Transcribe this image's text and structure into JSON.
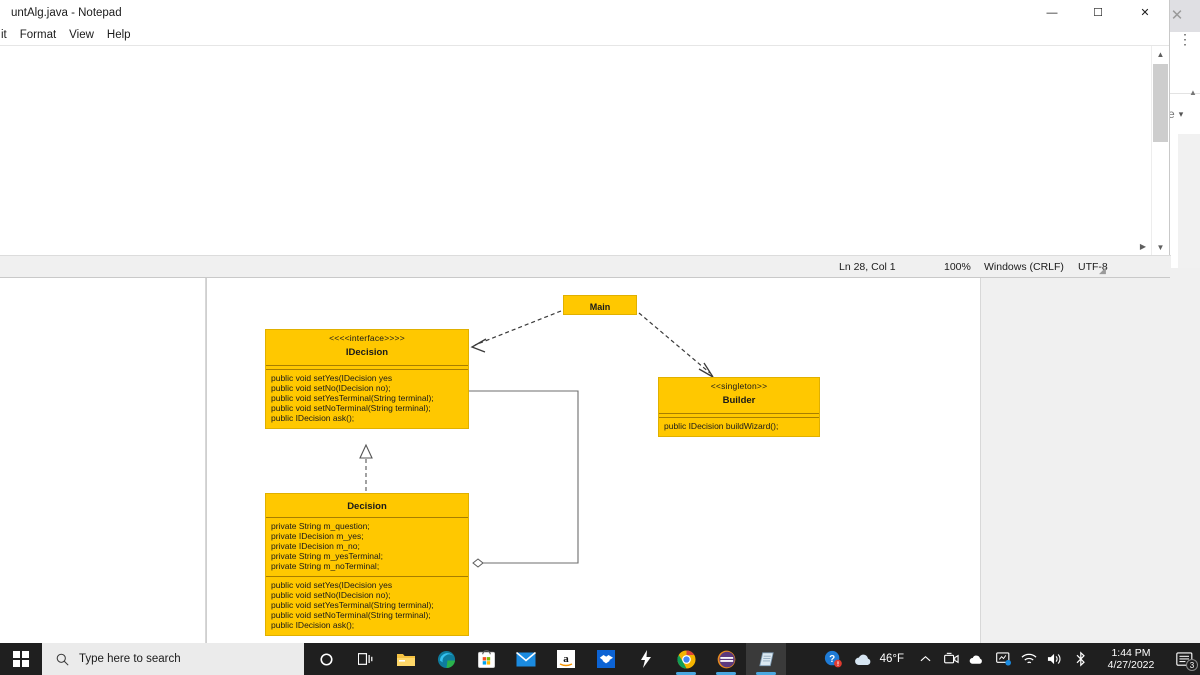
{
  "notepad": {
    "title": "untAlg.java - Notepad",
    "menu": [
      "it",
      "Format",
      "View",
      "Help"
    ],
    "window_controls": [
      {
        "name": "minimize",
        "glyph": "—"
      },
      {
        "name": "maximize",
        "glyph": "☐"
      },
      {
        "name": "close",
        "glyph": "✕"
      }
    ],
    "status": {
      "position": "Ln 28, Col 1",
      "zoom": "100%",
      "line_ending": "Windows (CRLF)",
      "encoding": "UTF-8"
    }
  },
  "background_window": {
    "close_glyph": "✕",
    "kebab_glyph": "⋮",
    "dropdown_label": "e",
    "dropdown_caret": "▾"
  },
  "diagram": {
    "type": "uml-class-diagram",
    "box_fill": "#FFC800",
    "box_border": "#E0B000",
    "separator_color": "#A87E00",
    "classes": [
      {
        "id": "main",
        "name": "Main",
        "stereotype": "",
        "attributes": [],
        "operations": []
      },
      {
        "id": "idecision",
        "name": "IDecision",
        "stereotype": "<<<<interface>>>>",
        "attributes": [],
        "operations": [
          "public void setYes(IDecision yes",
          "public void setNo(IDecision no);",
          "public void setYesTerminal(String terminal);",
          "public void setNoTerminal(String terminal);",
          "public IDecision ask();"
        ]
      },
      {
        "id": "builder",
        "name": "Builder",
        "stereotype": "<<singleton>>",
        "attributes": [],
        "operations": [
          "public IDecision buildWizard();"
        ]
      },
      {
        "id": "decision",
        "name": "Decision",
        "stereotype": "",
        "attributes": [
          "private String m_question;",
          "private IDecision m_yes;",
          "private IDecision m_no;",
          "private String m_yesTerminal;",
          "private String m_noTerminal;"
        ],
        "operations": [
          "public void setYes(IDecision yes",
          "public void setNo(IDecision no);",
          "public void setYesTerminal(String terminal);",
          "public void setNoTerminal(String terminal);",
          "public IDecision ask();"
        ]
      }
    ],
    "relations": [
      {
        "from": "main",
        "to": "idecision",
        "kind": "dependency",
        "style": "dashed-open-arrow"
      },
      {
        "from": "main",
        "to": "builder",
        "kind": "dependency",
        "style": "dashed-open-arrow"
      },
      {
        "from": "decision",
        "to": "idecision",
        "kind": "realization",
        "style": "dashed-hollow-triangle"
      },
      {
        "from": "decision",
        "to": "idecision",
        "kind": "aggregation",
        "style": "solid-hollow-diamond"
      }
    ]
  },
  "taskbar": {
    "start_name": "windows-start",
    "search_placeholder": "Type here to search",
    "buttons": [
      {
        "name": "cortana",
        "glyph": "◯"
      },
      {
        "name": "task-view",
        "glyph": "⧉"
      }
    ],
    "apps": [
      {
        "name": "file-explorer",
        "label": "File Explorer",
        "running": false
      },
      {
        "name": "microsoft-edge",
        "label": "Microsoft Edge",
        "running": false
      },
      {
        "name": "microsoft-store",
        "label": "Microsoft Store",
        "running": false
      },
      {
        "name": "mail",
        "label": "Mail",
        "running": false
      },
      {
        "name": "amazon",
        "label": "Amazon",
        "running": false
      },
      {
        "name": "dropbox",
        "label": "Dropbox",
        "running": false
      },
      {
        "name": "lightning-app",
        "label": "Lightning",
        "running": false
      },
      {
        "name": "google-chrome",
        "label": "Google Chrome",
        "running": true
      },
      {
        "name": "eclipse",
        "label": "Eclipse",
        "running": true
      },
      {
        "name": "notepad",
        "label": "Notepad",
        "running": true,
        "active": true
      }
    ],
    "tray": {
      "help_icon": "help-with-alert",
      "weather_temp": "46°F",
      "weather_icon": "cloud-icon",
      "overflow_glyph": "˄",
      "icons": [
        {
          "name": "camera-icon",
          "glyph": "□"
        },
        {
          "name": "onedrive-icon",
          "glyph": "☁"
        },
        {
          "name": "display-icon",
          "glyph": "❑"
        },
        {
          "name": "wifi-icon",
          "glyph": "◠"
        },
        {
          "name": "volume-icon",
          "glyph": "◁"
        },
        {
          "name": "bluetooth-icon",
          "glyph": "฿"
        }
      ],
      "time": "1:44 PM",
      "date": "4/27/2022",
      "notification_count": "3"
    }
  }
}
